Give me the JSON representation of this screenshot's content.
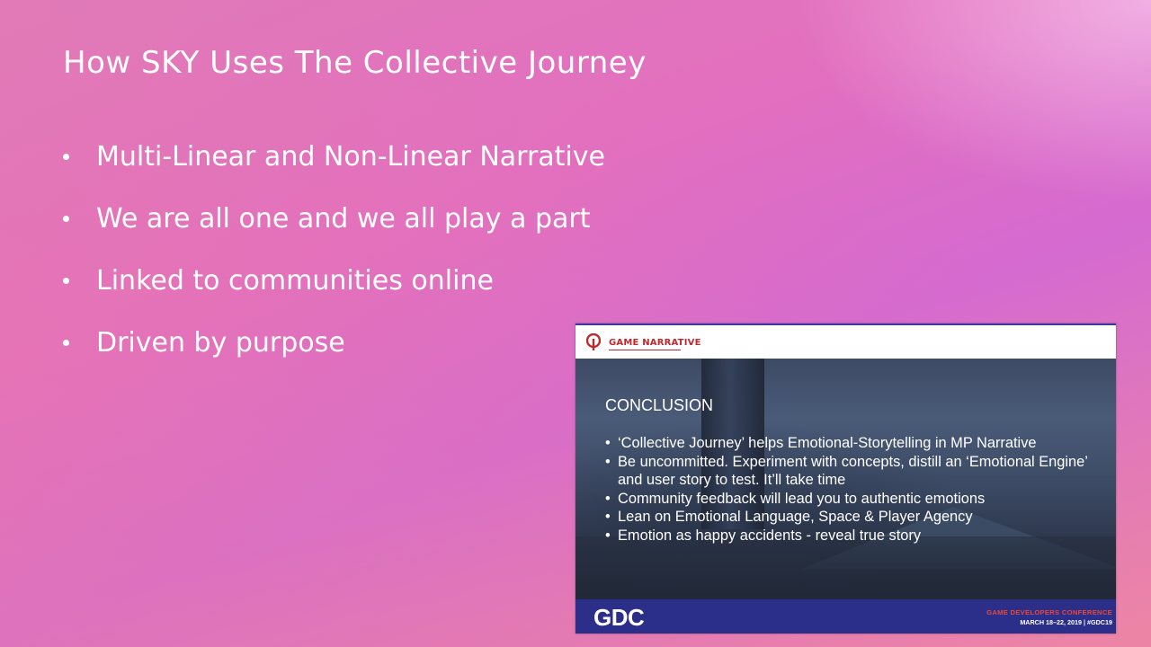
{
  "slide": {
    "title": "How SKY Uses The Collective Journey",
    "bullets": [
      "Multi-Linear and Non-Linear Narrative",
      "We are all one and we all play a part",
      "Linked to communities online",
      "Driven by purpose"
    ]
  },
  "embedded_slide": {
    "header_logo_text": "GAME NARRATIVE",
    "conclusion_title": "CONCLUSION",
    "points": [
      "‘Collective Journey’ helps Emotional-Storytelling in MP Narrative",
      "Be uncommitted. Experiment with concepts, distill an ‘Emotional Engine’ and user story to test. It’ll take time",
      "Community feedback will lead you to authentic emotions",
      "Lean on Emotional Language, Space & Player Agency",
      "Emotion as happy accidents - reveal true story"
    ],
    "footer": {
      "logo_text": "GDC",
      "conference_name": "GAME DEVELOPERS CONFERENCE",
      "conference_date": "MARCH 18–22, 2019 | #GDC19"
    }
  },
  "colors": {
    "background_pink": "#e07ab8",
    "background_magenta": "#d56ad0",
    "gdc_footer_blue": "#2c2f8a",
    "gns_red": "#c0282d"
  }
}
